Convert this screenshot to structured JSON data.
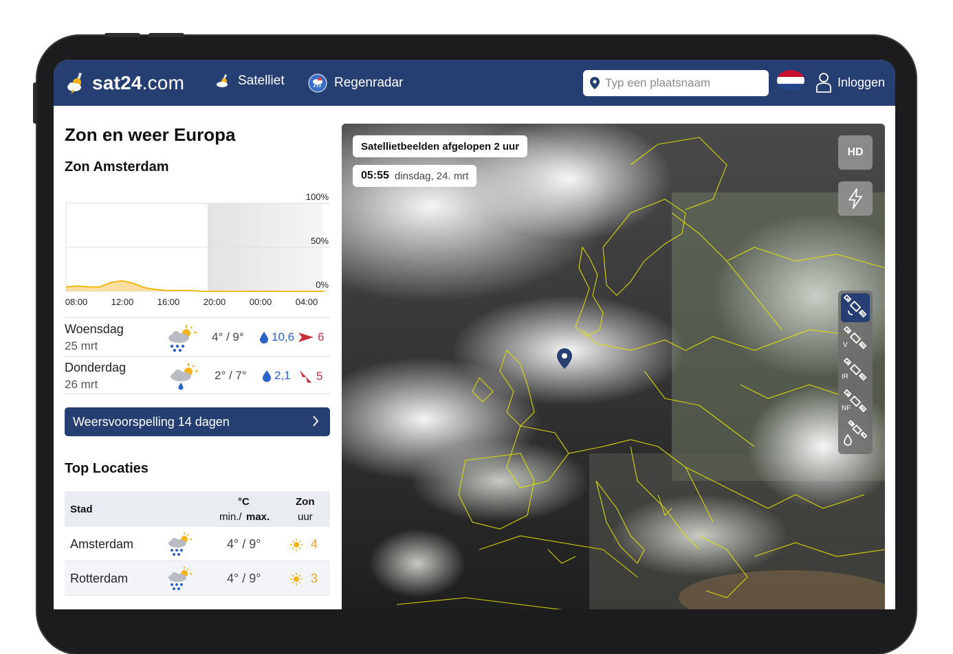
{
  "header": {
    "logo_bold": "sat24",
    "logo_rest": ".com",
    "nav": [
      {
        "label": "Satelliet",
        "icon": "satellite-cloud-icon"
      },
      {
        "label": "Regenradar",
        "icon": "rain-radar-icon"
      }
    ],
    "search_placeholder": "Typ een plaatsnaam",
    "language_flag": "nl-flag-icon",
    "login_label": "Inloggen"
  },
  "sidebar": {
    "title": "Zon en weer Europa",
    "sun_heading": "Zon Amsterdam",
    "chart_data": {
      "type": "area",
      "title": "",
      "x": [
        "08:00",
        "12:00",
        "16:00",
        "20:00",
        "00:00",
        "04:00"
      ],
      "y_ticks": [
        "100%",
        "50%",
        "0%"
      ],
      "ylim": [
        0,
        100
      ],
      "series": [
        {
          "values": [
            5,
            6,
            5,
            5,
            10,
            12,
            9,
            4,
            2,
            1,
            1,
            1,
            0,
            0,
            0,
            0,
            0,
            0,
            0,
            0,
            0,
            0,
            0,
            0
          ]
        }
      ],
      "night_start": "20:00",
      "color": "#f0b400"
    },
    "days": [
      {
        "name": "Woensdag",
        "date": "25 mrt",
        "icon": "partly-sunny-rain-icon",
        "temp": "4° / 9°",
        "rain": "10,6",
        "wind": "6",
        "wind_dir": "east"
      },
      {
        "name": "Donderdag",
        "date": "26 mrt",
        "icon": "partly-sunny-light-rain-icon",
        "temp": "2° / 7°",
        "rain": "2,1",
        "wind": "5",
        "wind_dir": "north-east"
      }
    ],
    "forecast_button": "Weersvoorspelling 14 dagen",
    "top_heading": "Top Locaties",
    "table": {
      "col_city": "Stad",
      "col_temp_unit": "°C",
      "col_temp_min": "min./",
      "col_temp_max": "max.",
      "col_sun": "Zon",
      "col_sun_unit": "uur",
      "rows": [
        {
          "city": "Amsterdam",
          "temp": "4° / 9°",
          "sun": "4"
        },
        {
          "city": "Rotterdam",
          "temp": "4° / 9°",
          "sun": "3"
        }
      ]
    }
  },
  "map": {
    "caption": "Satellietbeelden afgelopen 2 uur",
    "time": "05:55",
    "date": "dinsdag, 24. mrt",
    "hd_label": "HD",
    "layers": [
      {
        "label": "",
        "icon": "satellite-icon",
        "active": true
      },
      {
        "label": "V",
        "icon": "satellite-visible-icon",
        "active": false
      },
      {
        "label": "IR",
        "icon": "satellite-infrared-icon",
        "active": false
      },
      {
        "label": "NF",
        "icon": "satellite-night-fog-icon",
        "active": false
      },
      {
        "label": "",
        "icon": "satellite-precipitation-icon",
        "active": false
      }
    ]
  }
}
